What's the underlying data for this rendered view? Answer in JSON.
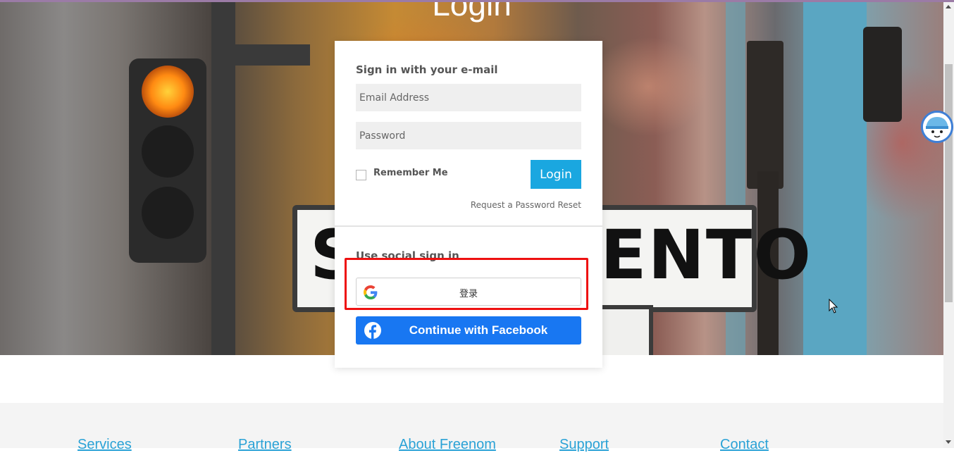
{
  "hero": {
    "title": "Login",
    "sign_left": "S",
    "sign_right": "ENTO"
  },
  "login": {
    "email_section_title": "Sign in with your e-mail",
    "email_placeholder": "Email Address",
    "password_placeholder": "Password",
    "remember_label": "Remember Me",
    "login_button": "Login",
    "reset_link": "Request a Password Reset",
    "social_section_title": "Use social sign in",
    "google_button": "登录",
    "facebook_button": "Continue with Facebook"
  },
  "footer": {
    "links": [
      "Services",
      "Partners",
      "About Freenom",
      "Support",
      "Contact"
    ]
  },
  "colors": {
    "accent": "#1aa7e0",
    "facebook": "#1877f2",
    "highlight": "#ee1111",
    "footer_link": "#2aa2d6"
  },
  "icons": {
    "google": "google-logo-icon",
    "facebook": "facebook-logo-icon",
    "avatar": "assistant-avatar-icon",
    "cursor": "mouse-cursor-icon"
  }
}
